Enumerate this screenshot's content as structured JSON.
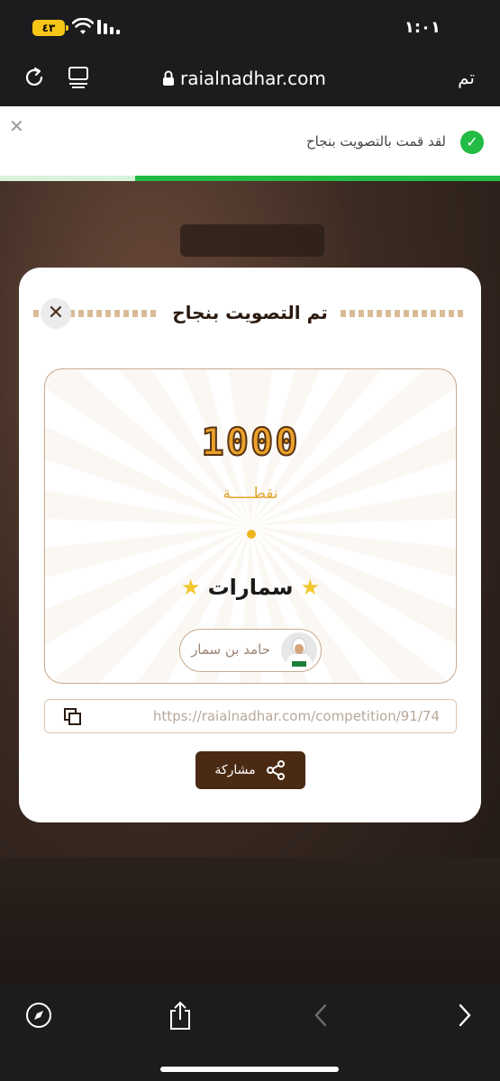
{
  "status_bar": {
    "time": "١:٠١",
    "battery": "٤٣"
  },
  "browser": {
    "url": "raialnadhar.com",
    "done_label": "تم"
  },
  "notification": {
    "text": "لقد قمت بالتصويت بنجاح",
    "progress": 0.73,
    "accent": "#22bb44"
  },
  "modal": {
    "title": "تم التصويت بنجاح",
    "points": "1000",
    "points_label": "نقطـــــة",
    "team_name": "سمارات",
    "person_name": "حامد بن سمار",
    "share_link": "https://raialnadhar.com/competition/91/74",
    "share_label": "مشاركة"
  },
  "colors": {
    "primary_brown": "#4b2a14",
    "gold": "#e9a12a",
    "border_tan": "#c7a98d"
  },
  "icons": [
    "reload-icon",
    "tabs-icon",
    "lock-icon",
    "close-icon",
    "check-icon",
    "star-icon",
    "copy-icon",
    "share-icon",
    "compass-icon",
    "share-upload-icon",
    "back-icon",
    "forward-icon"
  ]
}
